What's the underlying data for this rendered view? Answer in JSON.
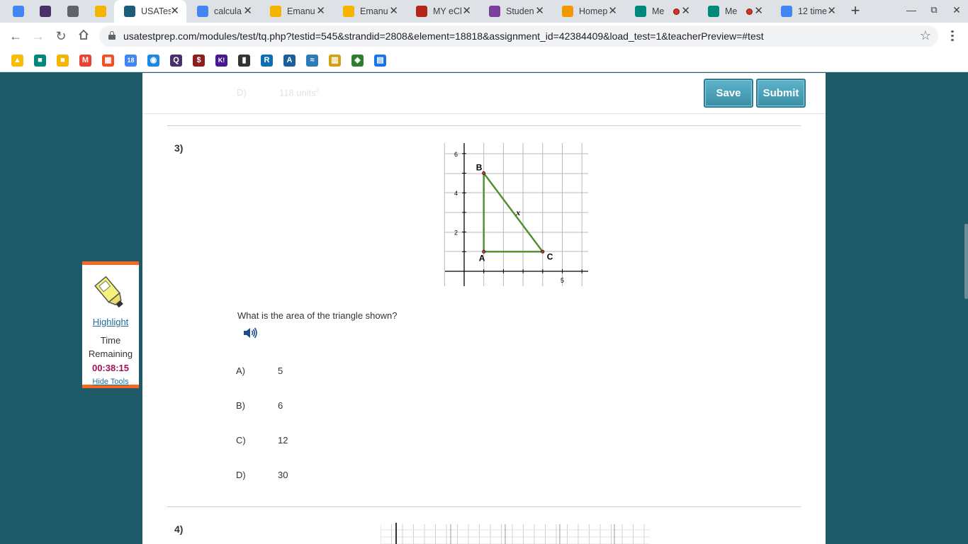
{
  "browser": {
    "tabs": [
      {
        "title": "",
        "icon": "contacts-icon",
        "color": "#4285f4",
        "pinned": true
      },
      {
        "title": "",
        "icon": "quizlet-icon",
        "color": "#4a2f6b",
        "pinned": true
      },
      {
        "title": "",
        "icon": "audio-muted-icon",
        "color": "#5f6368",
        "pinned": true
      },
      {
        "title": "",
        "icon": "classroom-icon",
        "color": "#f4b400",
        "pinned": true
      },
      {
        "title": "USATes",
        "icon": "cursor-icon",
        "color": "#1c5e7a",
        "active": true
      },
      {
        "title": "calcula",
        "icon": "google-icon",
        "color": "#4285f4"
      },
      {
        "title": "Emanu",
        "icon": "slides-icon",
        "color": "#f4b400"
      },
      {
        "title": "Emanu",
        "icon": "slides-icon",
        "color": "#f4b400"
      },
      {
        "title": "MY eCl",
        "icon": "school-icon",
        "color": "#b3261e"
      },
      {
        "title": "Studen",
        "icon": "pinwheel-icon",
        "color": "#7b3fa0"
      },
      {
        "title": "Homep",
        "icon": "bitmoji-icon",
        "color": "#f29900"
      },
      {
        "title": "Me",
        "icon": "meet-icon",
        "color": "#00897b",
        "recording": true
      },
      {
        "title": "Me",
        "icon": "meet-icon",
        "color": "#00897b",
        "recording": true
      },
      {
        "title": "12 time",
        "icon": "google-icon",
        "color": "#4285f4"
      }
    ],
    "url": "usatestprep.com/modules/test/tq.php?testid=545&strandid=2808&element=18818&assignment_id=42384409&load_test=1&teacherPreview=#test",
    "bookmarks": [
      {
        "icon": "drive-icon",
        "color": "#fbbc04",
        "glyph": "▲"
      },
      {
        "icon": "meet-icon",
        "color": "#00897b",
        "glyph": "■"
      },
      {
        "icon": "classroom-icon",
        "color": "#f4b400",
        "glyph": "■"
      },
      {
        "icon": "gmail-icon",
        "color": "#ea4335",
        "glyph": "M"
      },
      {
        "icon": "microsoft-icon",
        "color": "#f25022",
        "glyph": "▦"
      },
      {
        "icon": "calendar-icon",
        "color": "#4285f4",
        "glyph": "18"
      },
      {
        "icon": "compass-icon",
        "color": "#1e88e5",
        "glyph": "◉"
      },
      {
        "icon": "quizlet-icon",
        "color": "#4a2f6b",
        "glyph": "Q"
      },
      {
        "icon": "dollar-icon",
        "color": "#8e1d1d",
        "glyph": "$"
      },
      {
        "icon": "kahoot-icon",
        "color": "#46178f",
        "glyph": "K!"
      },
      {
        "icon": "book-icon",
        "color": "#333333",
        "glyph": "▮"
      },
      {
        "icon": "r-icon",
        "color": "#0b6db3",
        "glyph": "R"
      },
      {
        "icon": "a-icon",
        "color": "#1c5e9a",
        "glyph": "A"
      },
      {
        "icon": "wave-icon",
        "color": "#2b7bb9",
        "glyph": "≈"
      },
      {
        "icon": "library-icon",
        "color": "#d4a017",
        "glyph": "▥"
      },
      {
        "icon": "owl-icon",
        "color": "#2e7d32",
        "glyph": "◈"
      },
      {
        "icon": "layout-icon",
        "color": "#1a73e8",
        "glyph": "▤"
      }
    ]
  },
  "header": {
    "prev_choice_letter": "D)",
    "prev_choice_value": "118 units",
    "save_label": "Save",
    "submit_label": "Submit"
  },
  "question3": {
    "number": "3)",
    "graph": {
      "y_ticks": [
        "6",
        "4",
        "2"
      ],
      "x_ticks": [
        "5"
      ],
      "points": [
        {
          "label": "B",
          "x": 1,
          "y": 5
        },
        {
          "label": "A",
          "x": 1,
          "y": 1
        },
        {
          "label": "C",
          "x": 4,
          "y": 1
        }
      ],
      "side_label": "x",
      "triangle_color": "#4a8f2c"
    },
    "prompt": "What is the area of the triangle shown?",
    "choices": [
      {
        "letter": "A)",
        "value": "5"
      },
      {
        "letter": "B)",
        "value": "6"
      },
      {
        "letter": "C)",
        "value": "12"
      },
      {
        "letter": "D)",
        "value": "30"
      }
    ]
  },
  "question4": {
    "number": "4)"
  },
  "tools": {
    "highlight_label": "Highlight",
    "time_label": "Time Remaining",
    "timer": "00:38:15",
    "hide_label": "Hide Tools"
  }
}
